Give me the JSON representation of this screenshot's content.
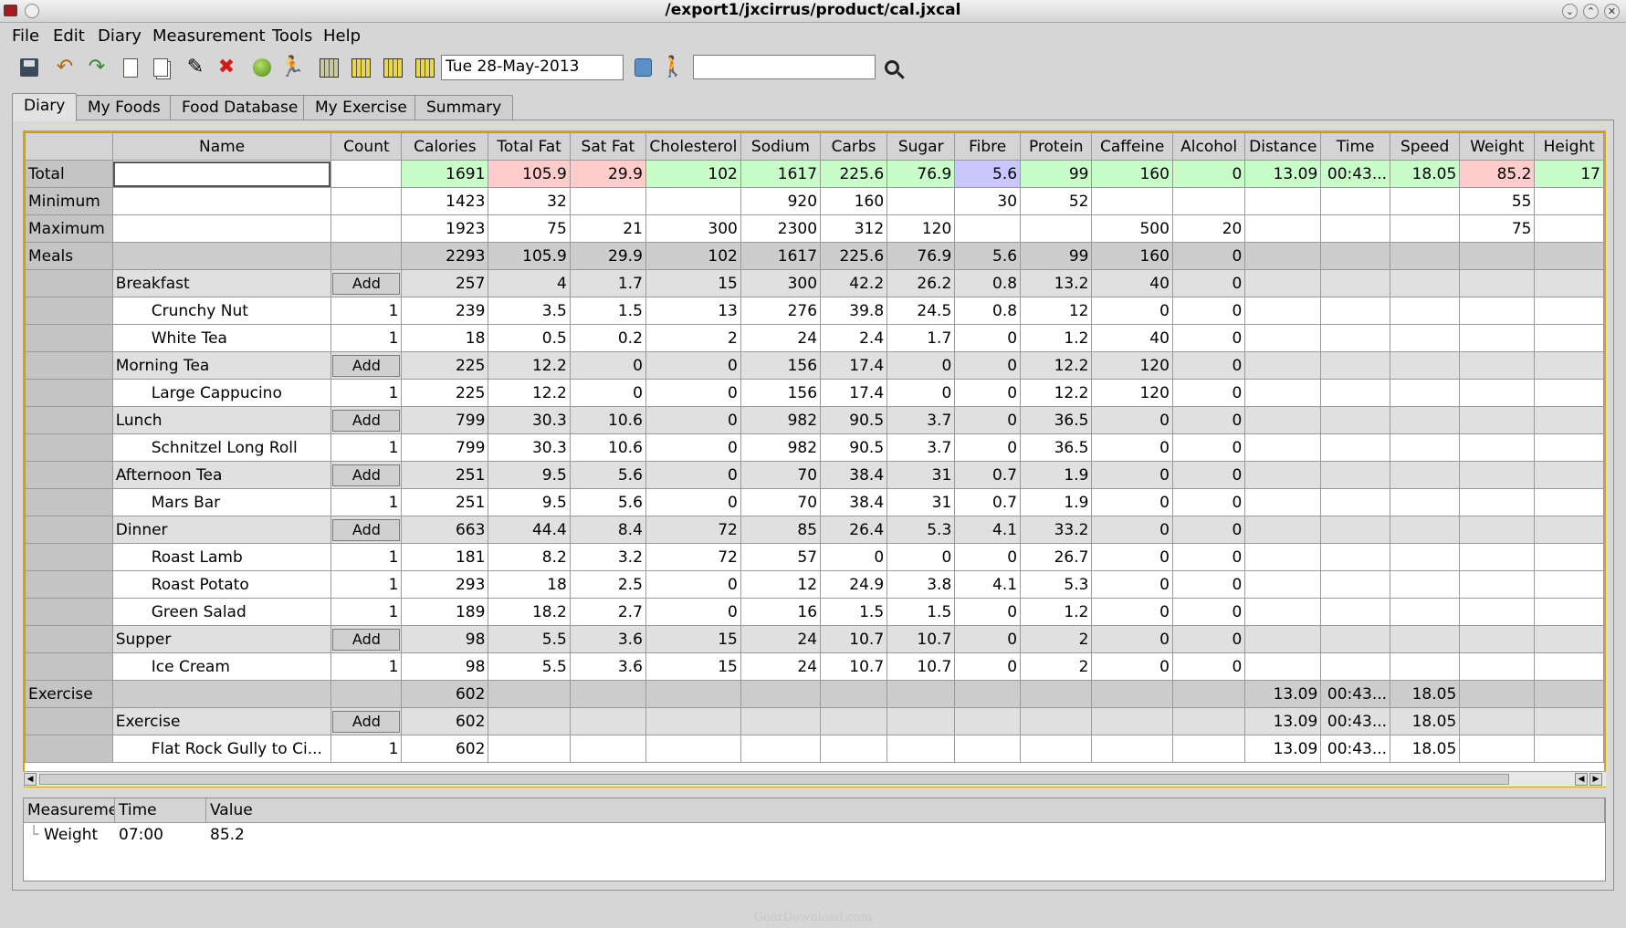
{
  "window": {
    "title": "/export1/jxcirrus/product/cal.jxcal",
    "controls": [
      "⌄",
      "⌃",
      "✕"
    ]
  },
  "menu": [
    "File",
    "Edit",
    "Diary",
    "Measurement",
    "Tools",
    "Help"
  ],
  "toolbar": {
    "date_value": "Tue 28-May-2013",
    "search_value": "",
    "icons": [
      "save-icon",
      "undo-icon",
      "redo-icon",
      "new-icon",
      "copy-icon",
      "edit-icon",
      "delete-icon",
      "food-icon",
      "exercise-icon",
      "grid-first-icon",
      "grid-prev-icon",
      "grid-next-icon",
      "grid-last-icon",
      "calendar-icon",
      "person-icon",
      "search-icon"
    ]
  },
  "tabs": [
    "Diary",
    "My Foods",
    "Food Database",
    "My Exercise",
    "Summary"
  ],
  "active_tab": "Diary",
  "grid": {
    "columns": [
      "",
      "Name",
      "Count",
      "Calories",
      "Total Fat",
      "Sat Fat",
      "Cholesterol",
      "Sodium",
      "Carbs",
      "Sugar",
      "Fibre",
      "Protein",
      "Caffeine",
      "Alcohol",
      "Distance",
      "Time",
      "Speed",
      "Weight",
      "Height"
    ],
    "add_label": "Add",
    "colors": {
      "green": "#c8fcc8",
      "red": "#ffcccc",
      "blue": "#c8c8ff"
    },
    "rows": [
      {
        "type": "total",
        "head": "Total",
        "name": "",
        "count": "",
        "values": [
          "1691",
          "105.9",
          "29.9",
          "102",
          "1617",
          "225.6",
          "76.9",
          "5.6",
          "99",
          "160",
          "0",
          "13.09",
          "00:43...",
          "18.05",
          "85.2",
          "17"
        ],
        "colors": [
          "green",
          "red",
          "red",
          "green",
          "green",
          "green",
          "green",
          "blue",
          "green",
          "green",
          "green",
          "green",
          "green",
          "green",
          "red",
          "green"
        ]
      },
      {
        "type": "limit",
        "head": "Minimum",
        "name": "",
        "count": "",
        "values": [
          "1423",
          "32",
          "",
          "",
          "920",
          "160",
          "",
          "30",
          "52",
          "",
          "",
          "",
          "",
          "",
          "55",
          ""
        ]
      },
      {
        "type": "limit",
        "head": "Maximum",
        "name": "",
        "count": "",
        "values": [
          "1923",
          "75",
          "21",
          "300",
          "2300",
          "312",
          "120",
          "",
          "",
          "500",
          "20",
          "",
          "",
          "",
          "75",
          ""
        ]
      },
      {
        "type": "sum",
        "head": "Meals",
        "name": "",
        "count": "",
        "values": [
          "2293",
          "105.9",
          "29.9",
          "102",
          "1617",
          "225.6",
          "76.9",
          "5.6",
          "99",
          "160",
          "0",
          "",
          "",
          "",
          "",
          ""
        ]
      },
      {
        "type": "meal",
        "head": "",
        "name": "Breakfast",
        "count": "add",
        "values": [
          "257",
          "4",
          "1.7",
          "15",
          "300",
          "42.2",
          "26.2",
          "0.8",
          "13.2",
          "40",
          "0",
          "",
          "",
          "",
          "",
          ""
        ]
      },
      {
        "type": "item",
        "head": "",
        "name": "Crunchy Nut",
        "count": "1",
        "values": [
          "239",
          "3.5",
          "1.5",
          "13",
          "276",
          "39.8",
          "24.5",
          "0.8",
          "12",
          "0",
          "0",
          "",
          "",
          "",
          "",
          ""
        ]
      },
      {
        "type": "item",
        "head": "",
        "name": "White Tea",
        "count": "1",
        "values": [
          "18",
          "0.5",
          "0.2",
          "2",
          "24",
          "2.4",
          "1.7",
          "0",
          "1.2",
          "40",
          "0",
          "",
          "",
          "",
          "",
          ""
        ]
      },
      {
        "type": "meal",
        "head": "",
        "name": "Morning Tea",
        "count": "add",
        "values": [
          "225",
          "12.2",
          "0",
          "0",
          "156",
          "17.4",
          "0",
          "0",
          "12.2",
          "120",
          "0",
          "",
          "",
          "",
          "",
          ""
        ]
      },
      {
        "type": "item",
        "head": "",
        "name": "Large Cappucino",
        "count": "1",
        "values": [
          "225",
          "12.2",
          "0",
          "0",
          "156",
          "17.4",
          "0",
          "0",
          "12.2",
          "120",
          "0",
          "",
          "",
          "",
          "",
          ""
        ]
      },
      {
        "type": "meal",
        "head": "",
        "name": "Lunch",
        "count": "add",
        "values": [
          "799",
          "30.3",
          "10.6",
          "0",
          "982",
          "90.5",
          "3.7",
          "0",
          "36.5",
          "0",
          "0",
          "",
          "",
          "",
          "",
          ""
        ]
      },
      {
        "type": "item",
        "head": "",
        "name": "Schnitzel Long Roll",
        "count": "1",
        "values": [
          "799",
          "30.3",
          "10.6",
          "0",
          "982",
          "90.5",
          "3.7",
          "0",
          "36.5",
          "0",
          "0",
          "",
          "",
          "",
          "",
          ""
        ]
      },
      {
        "type": "meal",
        "head": "",
        "name": "Afternoon Tea",
        "count": "add",
        "values": [
          "251",
          "9.5",
          "5.6",
          "0",
          "70",
          "38.4",
          "31",
          "0.7",
          "1.9",
          "0",
          "0",
          "",
          "",
          "",
          "",
          ""
        ]
      },
      {
        "type": "item",
        "head": "",
        "name": "Mars Bar",
        "count": "1",
        "values": [
          "251",
          "9.5",
          "5.6",
          "0",
          "70",
          "38.4",
          "31",
          "0.7",
          "1.9",
          "0",
          "0",
          "",
          "",
          "",
          "",
          ""
        ]
      },
      {
        "type": "meal",
        "head": "",
        "name": "Dinner",
        "count": "add",
        "values": [
          "663",
          "44.4",
          "8.4",
          "72",
          "85",
          "26.4",
          "5.3",
          "4.1",
          "33.2",
          "0",
          "0",
          "",
          "",
          "",
          "",
          ""
        ]
      },
      {
        "type": "item",
        "head": "",
        "name": "Roast Lamb",
        "count": "1",
        "values": [
          "181",
          "8.2",
          "3.2",
          "72",
          "57",
          "0",
          "0",
          "0",
          "26.7",
          "0",
          "0",
          "",
          "",
          "",
          "",
          ""
        ]
      },
      {
        "type": "item",
        "head": "",
        "name": "Roast Potato",
        "count": "1",
        "values": [
          "293",
          "18",
          "2.5",
          "0",
          "12",
          "24.9",
          "3.8",
          "4.1",
          "5.3",
          "0",
          "0",
          "",
          "",
          "",
          "",
          ""
        ]
      },
      {
        "type": "item",
        "head": "",
        "name": "Green Salad",
        "count": "1",
        "values": [
          "189",
          "18.2",
          "2.7",
          "0",
          "16",
          "1.5",
          "1.5",
          "0",
          "1.2",
          "0",
          "0",
          "",
          "",
          "",
          "",
          ""
        ]
      },
      {
        "type": "meal",
        "head": "",
        "name": "Supper",
        "count": "add",
        "values": [
          "98",
          "5.5",
          "3.6",
          "15",
          "24",
          "10.7",
          "10.7",
          "0",
          "2",
          "0",
          "0",
          "",
          "",
          "",
          "",
          ""
        ]
      },
      {
        "type": "item",
        "head": "",
        "name": "Ice Cream",
        "count": "1",
        "values": [
          "98",
          "5.5",
          "3.6",
          "15",
          "24",
          "10.7",
          "10.7",
          "0",
          "2",
          "0",
          "0",
          "",
          "",
          "",
          "",
          ""
        ]
      },
      {
        "type": "sum",
        "head": "Exercise",
        "name": "",
        "count": "",
        "values": [
          "602",
          "",
          "",
          "",
          "",
          "",
          "",
          "",
          "",
          "",
          "",
          "13.09",
          "00:43...",
          "18.05",
          "",
          ""
        ]
      },
      {
        "type": "meal",
        "head": "",
        "name": "Exercise",
        "count": "add",
        "values": [
          "602",
          "",
          "",
          "",
          "",
          "",
          "",
          "",
          "",
          "",
          "",
          "13.09",
          "00:43...",
          "18.05",
          "",
          ""
        ]
      },
      {
        "type": "item",
        "head": "",
        "name": "Flat Rock Gully to Ci...",
        "count": "1",
        "values": [
          "602",
          "",
          "",
          "",
          "",
          "",
          "",
          "",
          "",
          "",
          "",
          "13.09",
          "00:43...",
          "18.05",
          "",
          ""
        ]
      }
    ]
  },
  "measurements": {
    "columns": [
      "Measurement",
      "Time",
      "Value"
    ],
    "rows": [
      {
        "name": "Weight",
        "time": "07:00",
        "value": "85.2"
      }
    ]
  },
  "watermark": "GearDownload.com"
}
